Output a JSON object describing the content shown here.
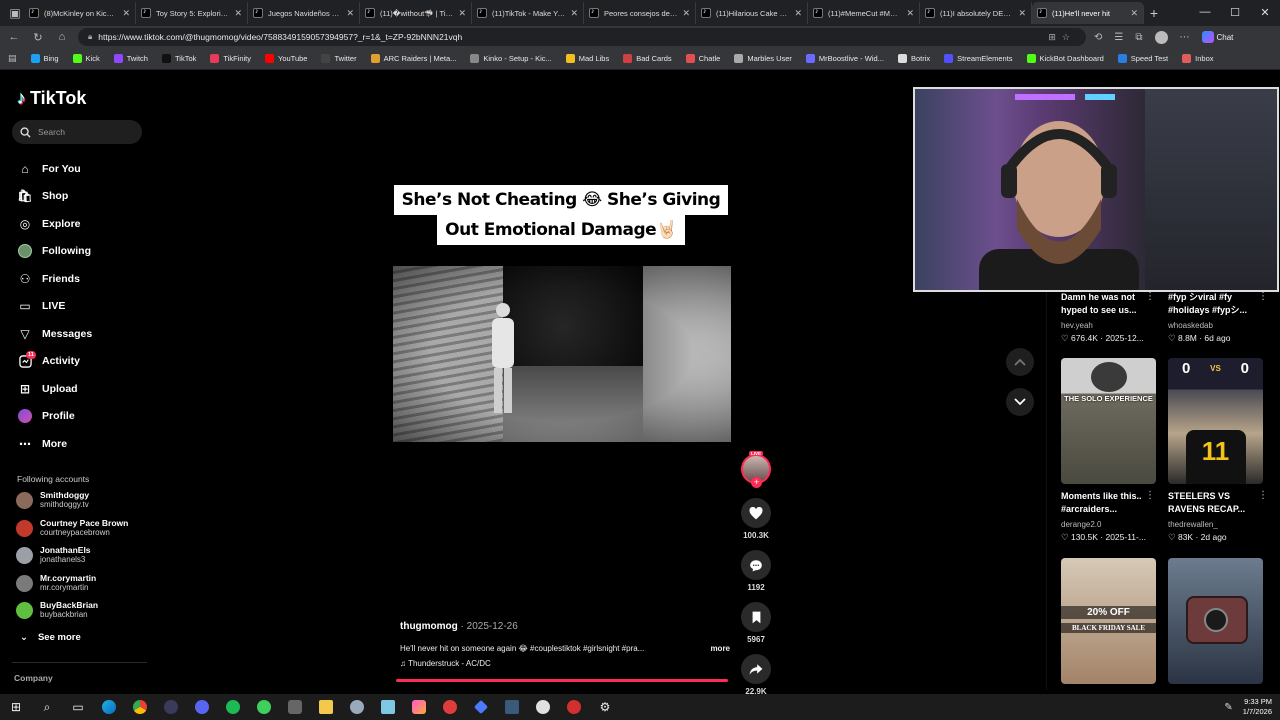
{
  "browser": {
    "tabs": [
      {
        "title": "(8)McKinley on Kick (@"
      },
      {
        "title": "Toy Story 5: Exploring t"
      },
      {
        "title": "Juegos Navideños para"
      },
      {
        "title": "(11)�without🦈 | TikTok"
      },
      {
        "title": "(11)TikTok - Make Your"
      },
      {
        "title": "Peores consejos de la"
      },
      {
        "title": "(11)Hilarious Cake Mem"
      },
      {
        "title": "(11)#MemeCut #Meme"
      },
      {
        "title": "(11)I absolutely DESPIS"
      },
      {
        "title": "(11)He'll never hit"
      }
    ],
    "url": "https://www.tiktok.com/@thugmomog/video/7588349159057394957?_r=1&_t=ZP-92bNNN21vqh",
    "chat_label": "Chat",
    "bookmarks": [
      {
        "label": "Bing",
        "color": "#1ba0f2"
      },
      {
        "label": "Kick",
        "color": "#53fc18"
      },
      {
        "label": "Twitch",
        "color": "#9146ff"
      },
      {
        "label": "TikTok",
        "color": "#111111"
      },
      {
        "label": "TikFinity",
        "color": "#e83a5a"
      },
      {
        "label": "YouTube",
        "color": "#ff0000"
      },
      {
        "label": "Twitter",
        "color": "#444444"
      },
      {
        "label": "ARC Raiders | Meta...",
        "color": "#e0a030"
      },
      {
        "label": "Kinko - Setup - Kic...",
        "color": "#888888"
      },
      {
        "label": "Mad Libs",
        "color": "#f0c020"
      },
      {
        "label": "Bad Cards",
        "color": "#d04040"
      },
      {
        "label": "Chatle",
        "color": "#e05050"
      },
      {
        "label": "Marbles User",
        "color": "#aaaaaa"
      },
      {
        "label": "MrBoostlive - Wid...",
        "color": "#6a6aff"
      },
      {
        "label": "Botrix",
        "color": "#dddddd"
      },
      {
        "label": "StreamElements",
        "color": "#5050ff"
      },
      {
        "label": "KickBot Dashboard",
        "color": "#53fc18"
      },
      {
        "label": "Speed Test",
        "color": "#2a7de1"
      }
    ],
    "bookmarks_end": "Inbox"
  },
  "sidebar": {
    "brand": "TikTok",
    "search_placeholder": "Search",
    "nav": [
      {
        "label": "For You",
        "icon": "home-icon"
      },
      {
        "label": "Shop",
        "icon": "shop-icon"
      },
      {
        "label": "Explore",
        "icon": "compass-icon"
      },
      {
        "label": "Following",
        "icon": "following-avatar-icon"
      },
      {
        "label": "Friends",
        "icon": "friends-icon"
      },
      {
        "label": "LIVE",
        "icon": "live-icon"
      },
      {
        "label": "Messages",
        "icon": "messages-icon"
      },
      {
        "label": "Activity",
        "icon": "activity-icon",
        "badge": "11"
      },
      {
        "label": "Upload",
        "icon": "upload-icon"
      },
      {
        "label": "Profile",
        "icon": "profile-icon"
      },
      {
        "label": "More",
        "icon": "more-icon"
      }
    ],
    "following_heading": "Following accounts",
    "following": [
      {
        "name": "Smithdoggy",
        "handle": "smithdoggy.tv",
        "color": "#8a6a5a"
      },
      {
        "name": "Courtney Pace Brown",
        "handle": "courtneypacebrown",
        "color": "#c0392b"
      },
      {
        "name": "JonathanEls",
        "handle": "jonathanels3",
        "color": "#9aa0a6"
      },
      {
        "name": "Mr.corymartin",
        "handle": "mr.corymartin",
        "color": "#7a7a7a"
      },
      {
        "name": "BuyBackBrian",
        "handle": "buybackbrian",
        "color": "#5fbf3f"
      }
    ],
    "see_more": "See more",
    "company": "Company"
  },
  "video": {
    "caption_line1": "She’s Not Cheating 😂 She’s Giving",
    "caption_line2": "Out Emotional Damage🤘🏻",
    "author": "thugmomog",
    "date": " · 2025-12-26",
    "description": "He'll never hit on someone again 😂 #couplestiktok #girlsnight #pra...",
    "more": "more",
    "music": "Thunderstruck - AC/DC",
    "likes": "100.3K",
    "comments": "1192",
    "saves": "5967",
    "shares": "22.9K",
    "live_tag": "LIVE"
  },
  "suggestions": [
    {
      "caption": "Damn he was not hyped to see us...",
      "user": "hev.yeah",
      "stat": "♡ 676.4K · 2025-12..."
    },
    {
      "caption": "#fyp シviral #fy #holidays #fypシ...",
      "user": "whoaskedab",
      "stat": "♡ 8.8M · 6d ago"
    },
    {
      "caption": "Moments like this.. #arcraiders...",
      "user": "derange2.0",
      "stat": "♡ 130.5K · 2025-11-..."
    },
    {
      "caption": "STEELERS VS RAVENS RECAP...",
      "user": "thedrewallen_",
      "stat": "♡ 83K · 2d ago"
    }
  ],
  "thumbs": {
    "solo": "THE SOLO EXPERIENCE",
    "vs": "VS",
    "score_left": "0",
    "score_right": "0",
    "jersey": "11",
    "sale_pct": "20% OFF",
    "sale_label": "BLACK FRIDAY SALE"
  },
  "taskbar": {
    "time": "9:33 PM",
    "date": "1/7/2026"
  }
}
